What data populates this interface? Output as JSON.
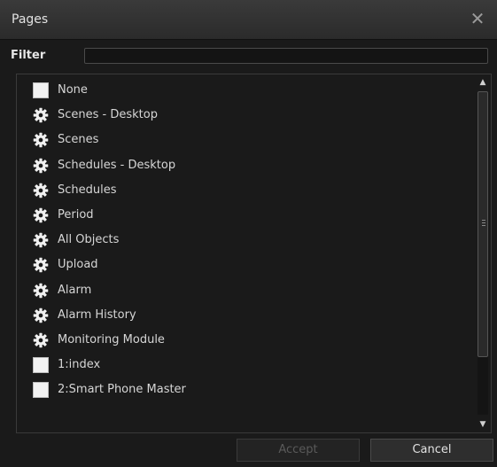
{
  "dialog": {
    "title": "Pages",
    "close_icon": "close-icon"
  },
  "filter": {
    "label": "Filter",
    "value": ""
  },
  "items": [
    {
      "label": "None",
      "icon": "page-icon"
    },
    {
      "label": "Scenes - Desktop",
      "icon": "gear-icon"
    },
    {
      "label": "Scenes",
      "icon": "gear-icon"
    },
    {
      "label": "Schedules - Desktop",
      "icon": "gear-icon"
    },
    {
      "label": "Schedules",
      "icon": "gear-icon"
    },
    {
      "label": "Period",
      "icon": "gear-icon"
    },
    {
      "label": "All Objects",
      "icon": "gear-icon"
    },
    {
      "label": "Upload",
      "icon": "gear-icon"
    },
    {
      "label": "Alarm",
      "icon": "gear-icon"
    },
    {
      "label": "Alarm History",
      "icon": "gear-icon"
    },
    {
      "label": "Monitoring Module",
      "icon": "gear-icon"
    },
    {
      "label": "1:index",
      "icon": "page-icon"
    },
    {
      "label": "2:Smart Phone Master",
      "icon": "page-icon"
    }
  ],
  "buttons": {
    "accept_label": "Accept",
    "cancel_label": "Cancel"
  },
  "colors": {
    "background": "#1a1a1a",
    "titlebar": "#333333",
    "accept_disabled_text": "#5a5a5a"
  }
}
